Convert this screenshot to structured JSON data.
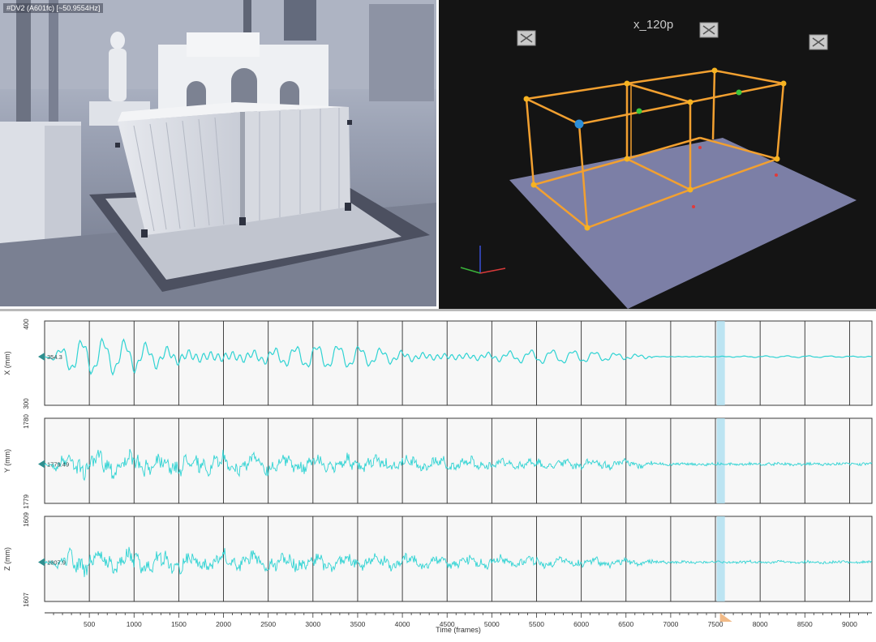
{
  "camera": {
    "title": "#DV2 (A601fc) [~50.9554Hz]"
  },
  "scene": {
    "title": "x_120p",
    "colors": {
      "background": "#141414",
      "floor": "#7c7fa6",
      "frame": "#f2a030",
      "node": "#f6b321",
      "marker_blue": "#2d8fd8",
      "marker_green": "#3cc63c",
      "marker_red": "#e23a3a"
    },
    "camera_icons": [
      "camera-icon",
      "camera-icon",
      "camera-icon"
    ]
  },
  "graphs": {
    "accent": "#2fd3d3",
    "cursor_color": "#a8def0",
    "x_axis_label": "Time (frames)",
    "x_ticks": [
      "500",
      "1000",
      "1500",
      "2000",
      "2500",
      "3000",
      "3500",
      "4000",
      "4500",
      "5000",
      "5500",
      "6000",
      "6500",
      "7000",
      "7500",
      "8000",
      "8500",
      "9000"
    ],
    "cursor_frame": 7560,
    "panels": [
      {
        "axis_label": "X (mm)",
        "tick_top": "400",
        "tick_bottom": "300",
        "current_value": "354.3"
      },
      {
        "axis_label": "Y (mm)",
        "tick_top": "1780",
        "tick_bottom": "1779",
        "current_value": "1779.49"
      },
      {
        "axis_label": "Z (mm)",
        "tick_top": "1609",
        "tick_bottom": "1607",
        "current_value": "1607.9"
      }
    ]
  }
}
